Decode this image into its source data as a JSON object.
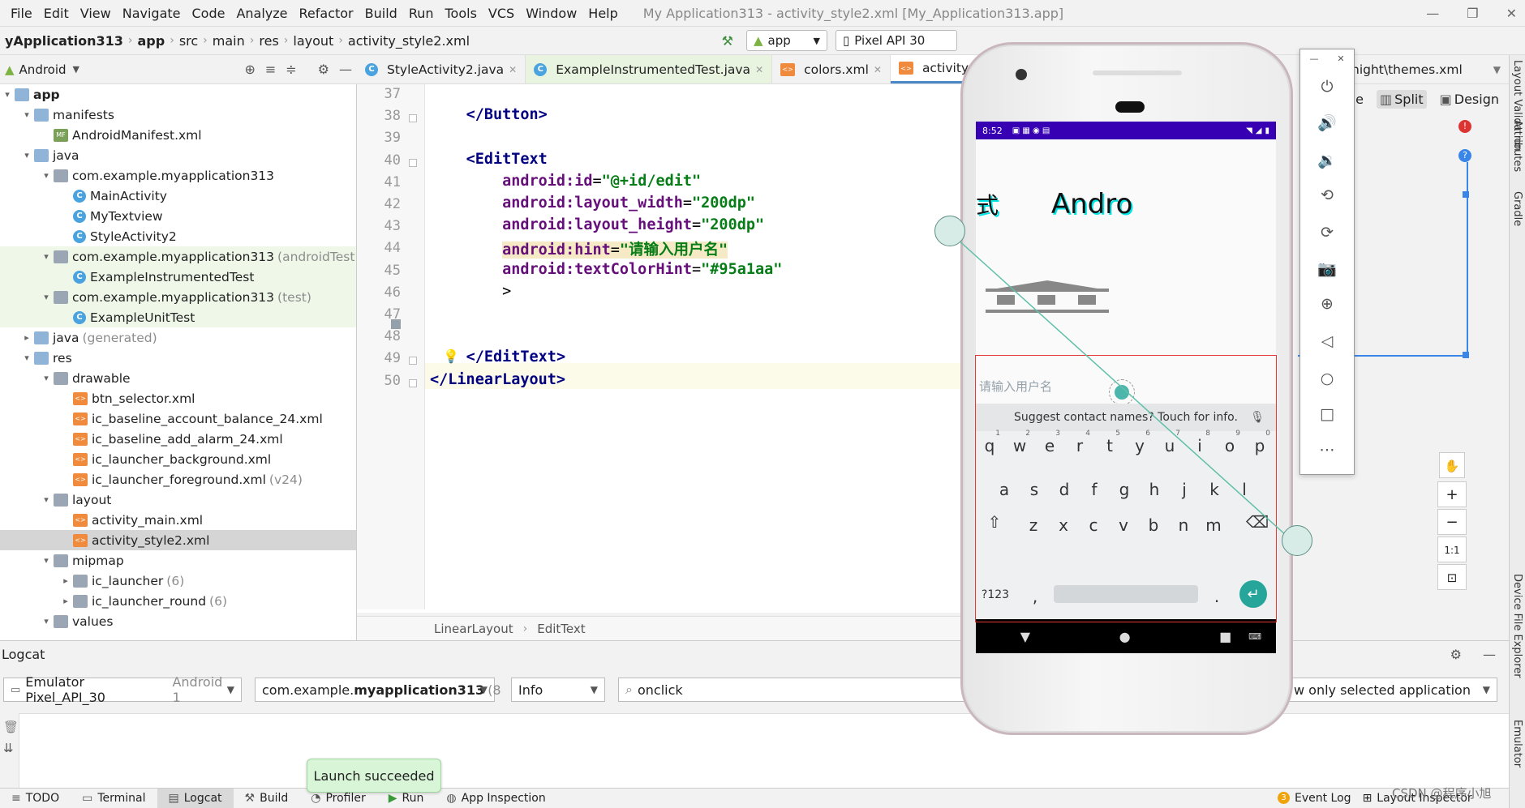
{
  "menu": [
    "File",
    "Edit",
    "View",
    "Navigate",
    "Code",
    "Analyze",
    "Refactor",
    "Build",
    "Run",
    "Tools",
    "VCS",
    "Window",
    "Help"
  ],
  "window_title": "My Application313 - activity_style2.xml [My_Application313.app]",
  "breadcrumb": [
    "yApplication313",
    "app",
    "src",
    "main",
    "res",
    "layout",
    "activity_style2.xml"
  ],
  "run_config": "app",
  "device": "Pixel API 30",
  "project_view": "Android",
  "tree": [
    {
      "label": "app",
      "level": 0,
      "arrow": "▾",
      "icon": "folder",
      "bold": true
    },
    {
      "label": "manifests",
      "level": 1,
      "arrow": "▾",
      "icon": "folder"
    },
    {
      "label": "AndroidManifest.xml",
      "level": 2,
      "arrow": "",
      "icon": "mf"
    },
    {
      "label": "java",
      "level": 1,
      "arrow": "▾",
      "icon": "folder"
    },
    {
      "label": "com.example.myapplication313",
      "level": 2,
      "arrow": "▾",
      "icon": "folder-g"
    },
    {
      "label": "MainActivity",
      "level": 3,
      "arrow": "",
      "icon": "cls"
    },
    {
      "label": "MyTextview",
      "level": 3,
      "arrow": "",
      "icon": "cls"
    },
    {
      "label": "StyleActivity2",
      "level": 3,
      "arrow": "",
      "icon": "cls"
    },
    {
      "label": "com.example.myapplication313",
      "suffix": "(androidTest",
      "level": 2,
      "arrow": "▾",
      "icon": "folder-g",
      "green": true
    },
    {
      "label": "ExampleInstrumentedTest",
      "level": 3,
      "arrow": "",
      "icon": "cls",
      "green": true
    },
    {
      "label": "com.example.myapplication313",
      "suffix": "(test)",
      "level": 2,
      "arrow": "▾",
      "icon": "folder-g",
      "green": true
    },
    {
      "label": "ExampleUnitTest",
      "level": 3,
      "arrow": "",
      "icon": "cls",
      "green": true
    },
    {
      "label": "java",
      "suffix": "(generated)",
      "level": 1,
      "arrow": "▸",
      "icon": "folder"
    },
    {
      "label": "res",
      "level": 1,
      "arrow": "▾",
      "icon": "folder"
    },
    {
      "label": "drawable",
      "level": 2,
      "arrow": "▾",
      "icon": "folder-g"
    },
    {
      "label": "btn_selector.xml",
      "level": 3,
      "arrow": "",
      "icon": "xml"
    },
    {
      "label": "ic_baseline_account_balance_24.xml",
      "level": 3,
      "arrow": "",
      "icon": "xml"
    },
    {
      "label": "ic_baseline_add_alarm_24.xml",
      "level": 3,
      "arrow": "",
      "icon": "xml"
    },
    {
      "label": "ic_launcher_background.xml",
      "level": 3,
      "arrow": "",
      "icon": "xml"
    },
    {
      "label": "ic_launcher_foreground.xml",
      "suffix": "(v24)",
      "level": 3,
      "arrow": "",
      "icon": "xml"
    },
    {
      "label": "layout",
      "level": 2,
      "arrow": "▾",
      "icon": "folder-g"
    },
    {
      "label": "activity_main.xml",
      "level": 3,
      "arrow": "",
      "icon": "xml"
    },
    {
      "label": "activity_style2.xml",
      "level": 3,
      "arrow": "",
      "icon": "xml",
      "selected": true
    },
    {
      "label": "mipmap",
      "level": 2,
      "arrow": "▾",
      "icon": "folder-g"
    },
    {
      "label": "ic_launcher",
      "suffix": "(6)",
      "level": 3,
      "arrow": "▸",
      "icon": "folder-g"
    },
    {
      "label": "ic_launcher_round",
      "suffix": "(6)",
      "level": 3,
      "arrow": "▸",
      "icon": "folder-g"
    },
    {
      "label": "values",
      "level": 2,
      "arrow": "▾",
      "icon": "folder-g"
    }
  ],
  "tabs": [
    {
      "label": "StyleActivity2.java",
      "icon": "C",
      "tinted": false
    },
    {
      "label": "ExampleInstrumentedTest.java",
      "icon": "C",
      "tinted": true
    },
    {
      "label": "colors.xml",
      "icon": "xml",
      "tinted": false
    },
    {
      "label": "activity_style2",
      "icon": "xml",
      "active": true
    }
  ],
  "right_tabs_partial": "night\\themes.xml",
  "view_modes": [
    "Code",
    "Split",
    "Design"
  ],
  "code_lines": [
    {
      "n": "37",
      "html": ""
    },
    {
      "n": "38",
      "html": "    <span class='tag'>&lt;/Button&gt;</span>"
    },
    {
      "n": "39",
      "html": ""
    },
    {
      "n": "40",
      "html": "    <span class='tag'>&lt;EditText</span>"
    },
    {
      "n": "41",
      "html": "        <span class='attr'>android:id</span>=<span class='val'>\"@+id/edit\"</span>"
    },
    {
      "n": "42",
      "html": "        <span class='attr'>android:layout_width</span>=<span class='val'>\"200dp\"</span>"
    },
    {
      "n": "43",
      "html": "        <span class='attr'>android:layout_height</span>=<span class='val'>\"200dp\"</span>"
    },
    {
      "n": "44",
      "html": "        <span class='attr hl-attr'>android:hint</span><span class='hl-attr'>=<span class='val'>\"请输入用户名\"</span></span>"
    },
    {
      "n": "45",
      "html": "        <span class='attr'>android:textColorHint</span>=<span class='val'>\"#95a1aa\"</span>"
    },
    {
      "n": "46",
      "html": "        &gt;"
    },
    {
      "n": "47",
      "html": ""
    },
    {
      "n": "48",
      "html": ""
    },
    {
      "n": "49",
      "html": "    <span class='tag'>&lt;/EditText&gt;</span>"
    },
    {
      "n": "50",
      "html": "<span class='tag'>&lt;/LinearLayout&gt;</span>"
    }
  ],
  "editor_breadcrumb": [
    "LinearLayout",
    "EditText"
  ],
  "logcat": {
    "title": "Logcat",
    "device": "Emulator Pixel_API_30",
    "device_suffix": "Android 1",
    "package_prefix": "com.example.",
    "package_bold": "myapplication313",
    "package_suffix": "(8",
    "level": "Info",
    "search": "onclick",
    "filter": "w only selected application"
  },
  "bottom_tools": [
    "TODO",
    "Terminal",
    "Logcat",
    "Build",
    "Profiler",
    "Run",
    "App Inspection"
  ],
  "bottom_right": [
    "Event Log",
    "Layout Inspector"
  ],
  "event_count": "3",
  "toast": "Launch succeeded",
  "right_strip": [
    "Layout Validation",
    "Attributes",
    "Gradle",
    "Device File Explorer",
    "Emulator"
  ],
  "watermark": "CSDN @程序小旭",
  "emulator": {
    "time": "8:52",
    "app_text_left": "式",
    "app_text": "Andro",
    "hint": "请输入用户名",
    "suggest": "Suggest contact names? Touch for info.",
    "row1": [
      "q",
      "w",
      "e",
      "r",
      "t",
      "y",
      "u",
      "i",
      "o",
      "p"
    ],
    "row1_nums": [
      "1",
      "2",
      "3",
      "4",
      "5",
      "6",
      "7",
      "8",
      "9",
      "0"
    ],
    "row2": [
      "a",
      "s",
      "d",
      "f",
      "g",
      "h",
      "j",
      "k",
      "l"
    ],
    "row3": [
      "z",
      "x",
      "c",
      "v",
      "b",
      "n",
      "m"
    ],
    "sym": "?123",
    "comma": ",",
    "period": ".",
    "hint_color": "#95a1aa",
    "status_color": "#3700b3"
  },
  "zoom": [
    "+",
    "−",
    "1:1"
  ]
}
